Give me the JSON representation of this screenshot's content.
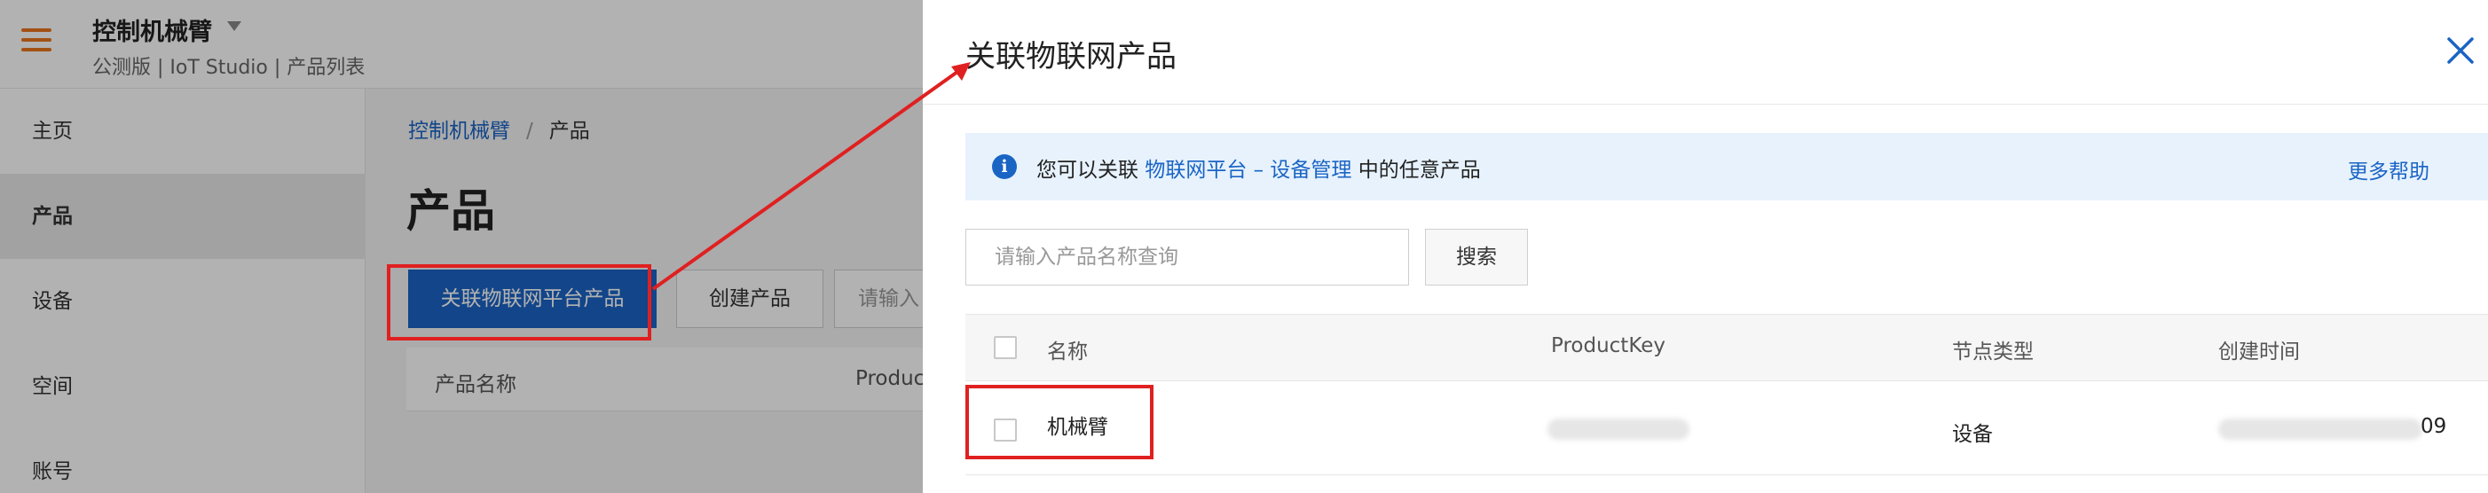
{
  "app": {
    "title": "控制机械臂",
    "subtitle": "公测版 | IoT Studio | 产品列表"
  },
  "sidebar": {
    "items": [
      {
        "label": "主页",
        "active": false
      },
      {
        "label": "产品",
        "active": true
      },
      {
        "label": "设备",
        "active": false
      },
      {
        "label": "空间",
        "active": false
      },
      {
        "label": "账号",
        "active": false
      }
    ]
  },
  "main": {
    "breadcrumb": {
      "root": "控制机械臂",
      "separator": "/",
      "current": "产品"
    },
    "page_title": "产品",
    "buttons": {
      "link_product": "关联物联网平台产品",
      "create_product": "创建产品",
      "search_partial": "请输入"
    },
    "table_headers": {
      "name": "产品名称",
      "product_key_partial": "Produc"
    }
  },
  "drawer": {
    "title": "关联物联网产品",
    "close_icon": "close-icon",
    "notice": {
      "icon": "info-icon",
      "text_prefix": "您可以关联",
      "link_text": "物联网平台 – 设备管理",
      "text_suffix": "中的任意产品",
      "help_link": "更多帮助"
    },
    "search": {
      "placeholder": "请输入产品名称查询",
      "value": "",
      "button_label": "搜索"
    },
    "table": {
      "headers": {
        "name": "名称",
        "product_key": "ProductKey",
        "node_type": "节点类型",
        "created_time": "创建时间"
      },
      "rows": [
        {
          "name": "机械臂",
          "product_key": "",
          "node_type": "设备",
          "created_time_suffix": "09"
        }
      ]
    }
  },
  "colors": {
    "accent_blue": "#1a64c4",
    "annotation_red": "#e02020",
    "hamburger_orange": "#e8751e",
    "notice_bg": "#e7f2fd"
  }
}
